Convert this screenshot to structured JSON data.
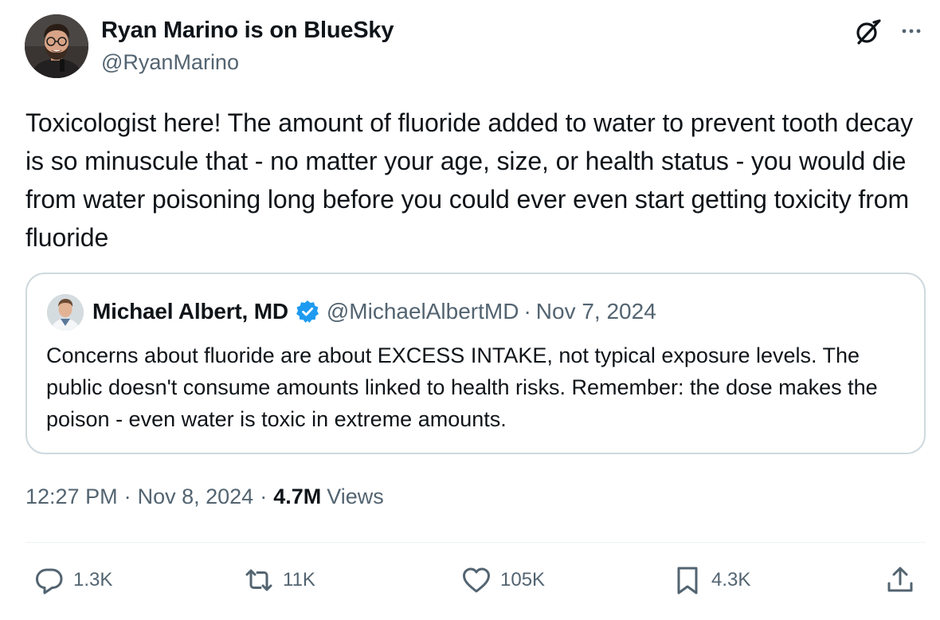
{
  "tweet": {
    "author": {
      "name": "Ryan Marino is on BlueSky",
      "handle": "@RyanMarino",
      "avatar_icon": "user-avatar-photo"
    },
    "text": "Toxicologist here! The amount of fluoride added to water to prevent tooth decay is so minuscule that - no matter your age, size, or health status - you would die from water poisoning long before you could ever even start getting toxicity from fluoride",
    "header_icons": [
      "grok-icon",
      "more-options-icon"
    ]
  },
  "quote": {
    "author_name": "Michael Albert, MD",
    "verified": true,
    "verified_color": "#1d9bf0",
    "handle": "@MichaelAlbertMD",
    "separator": "·",
    "date": "Nov 7, 2024",
    "text": "Concerns about fluoride are about EXCESS INTAKE, not typical exposure levels. The public doesn't consume amounts linked to health risks. Remember: the dose makes the poison - even water is toxic in extreme amounts."
  },
  "meta": {
    "time": "12:27 PM",
    "separator": "·",
    "date": "Nov 8, 2024",
    "views_count": "4.7M",
    "views_label": "Views"
  },
  "actions": {
    "replies": "1.3K",
    "reposts": "11K",
    "likes": "105K",
    "bookmarks": "4.3K"
  },
  "colors": {
    "text_primary": "#0f1419",
    "text_secondary": "#536471",
    "border": "#cfd9de",
    "divider": "#eff3f4"
  }
}
